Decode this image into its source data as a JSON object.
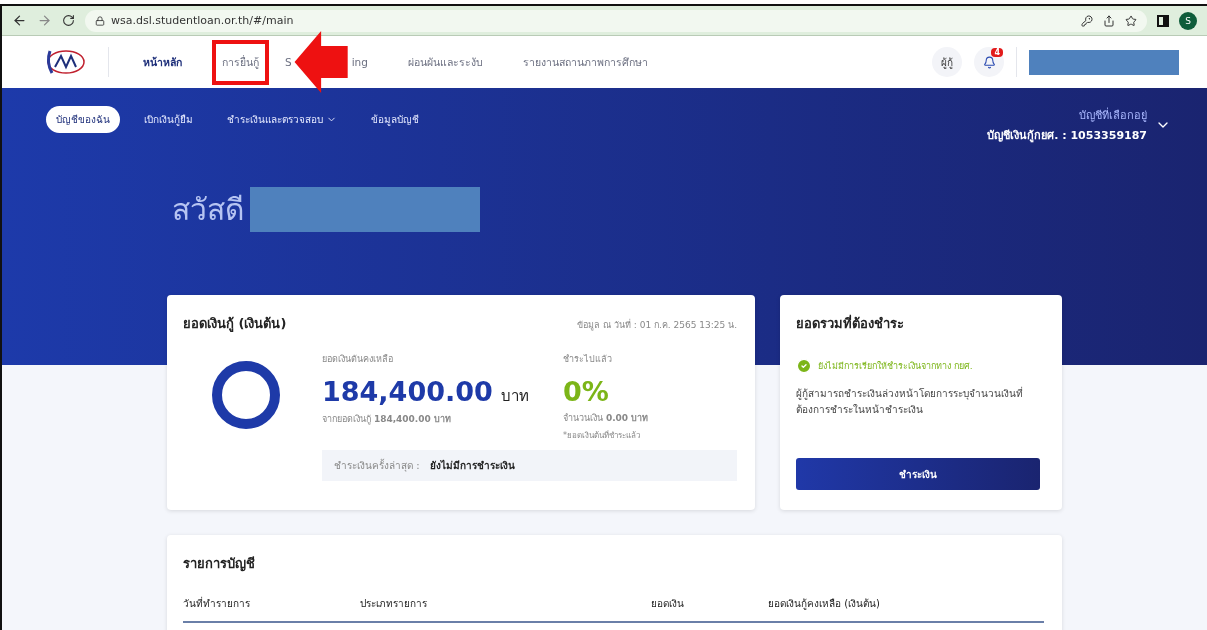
{
  "browser": {
    "url": "wsa.dsl.studentloan.or.th/#/main",
    "profile_initial": "S"
  },
  "header": {
    "nav": [
      {
        "label": "หน้าหลัก",
        "selected": true,
        "highlighted": false
      },
      {
        "label": "การยื่นกู้",
        "selected": false,
        "highlighted": true
      },
      {
        "label": "S",
        "label_end": "ing",
        "selected": false,
        "highlighted": false
      },
      {
        "label": "ผ่อนผันและระงับ",
        "selected": false,
        "highlighted": false
      },
      {
        "label": "รายงานสถานภาพการศึกษา",
        "selected": false,
        "highlighted": false
      }
    ],
    "role_chip": "ผู้กู้",
    "notification_count": "4"
  },
  "subnav": [
    {
      "label": "บัญชีของฉัน",
      "selected": true,
      "dropdown": false
    },
    {
      "label": "เบิกเงินกู้ยืม",
      "selected": false,
      "dropdown": false
    },
    {
      "label": "ชำระเงินและตรวจสอบ",
      "selected": false,
      "dropdown": true
    },
    {
      "label": "ข้อมูลบัญชี",
      "selected": false,
      "dropdown": false
    }
  ],
  "account_selector": {
    "caption": "บัญชีที่เลือกอยู่",
    "account": "บัญชีเงินกู้กยศ. : 1053359187"
  },
  "greeting": "สวัสดี",
  "loan_card": {
    "title": "ยอดเงินกู้ (เงินต้น)",
    "as_of": "ข้อมูล ณ วันที่ : 01 ก.ค. 2565 13:25 น.",
    "remaining_label": "ยอดเงินต้นคงเหลือ",
    "remaining_amount": "184,400.00",
    "remaining_unit": "บาท",
    "from_total": "จากยอดเงินกู้ **184,400.00 บาท**",
    "paid_label": "ชำระไปแล้ว",
    "paid_percent": "0%",
    "paid_amount": "จำนวนเงิน **0.00 บาท**",
    "paid_note": "*ยอดเงินต้นที่ชำระแล้ว",
    "last_payment_label": "ชำระเงินครั้งล่าสุด :",
    "last_payment_value": "ยังไม่มีการชำระเงิน"
  },
  "due_card": {
    "title": "ยอดรวมที่ต้องชำระ",
    "status": "ยังไม่มีการเรียกให้ชำระเงินจากทาง กยศ.",
    "description": "ผู้กู้สามารถชำระเงินล่วงหน้าโดยการระบุจำนวนเงินที่ต้องการชำระในหน้าชำระเงิน",
    "button": "ชำระเงิน"
  },
  "transactions": {
    "title": "รายการบัญชี",
    "columns": [
      "วันที่ทำรายการ",
      "ประเภทรายการ",
      "ยอดเงิน",
      "ยอดเงินกู้คงเหลือ (เงินต้น)"
    ]
  }
}
